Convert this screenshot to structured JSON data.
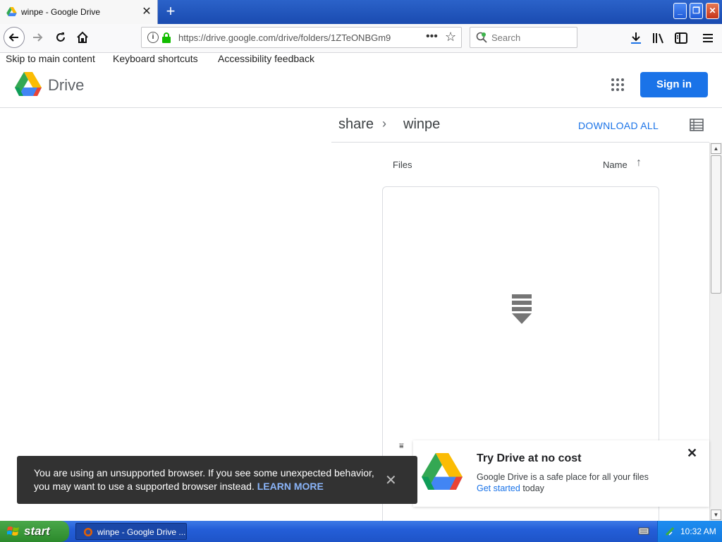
{
  "browser": {
    "tab_title": "winpe - Google Drive",
    "tab_close": "✕",
    "new_tab": "+",
    "url": "https://drive.google.com/drive/folders/1ZTeONBGm9",
    "search_placeholder": "Search",
    "window_buttons": {
      "minimize": "_",
      "maximize": "❐",
      "close": "✕"
    }
  },
  "skip_links": {
    "main": "Skip to main content",
    "keyboard": "Keyboard shortcuts",
    "accessibility": "Accessibility feedback"
  },
  "drive": {
    "brand": "Drive",
    "sign_in": "Sign in"
  },
  "breadcrumb": {
    "parent": "share",
    "separator": "›",
    "current": "winpe"
  },
  "toolbar": {
    "download_all": "DOWNLOAD ALL"
  },
  "list_header": {
    "files": "Files",
    "sort_by": "Name",
    "sort_arrow": "↑"
  },
  "snackbar": {
    "message": "You are using an unsupported browser. If you see some unexpected behavior, you may want to use a supported browser instead.",
    "link": "LEARN MORE",
    "close": "✕"
  },
  "promo": {
    "title": "Try Drive at no cost",
    "description": "Google Drive is a safe place for all your files",
    "cta_link": "Get started",
    "cta_rest": "today",
    "close": "✕"
  },
  "taskbar": {
    "start": "start",
    "task": "winpe - Google Drive ...",
    "clock": "10:32 AM"
  },
  "colors": {
    "accent": "#1a73e8",
    "snackbar_bg": "#323232",
    "taskbar": "#245ed8",
    "start_green": "#2c8a2c"
  }
}
